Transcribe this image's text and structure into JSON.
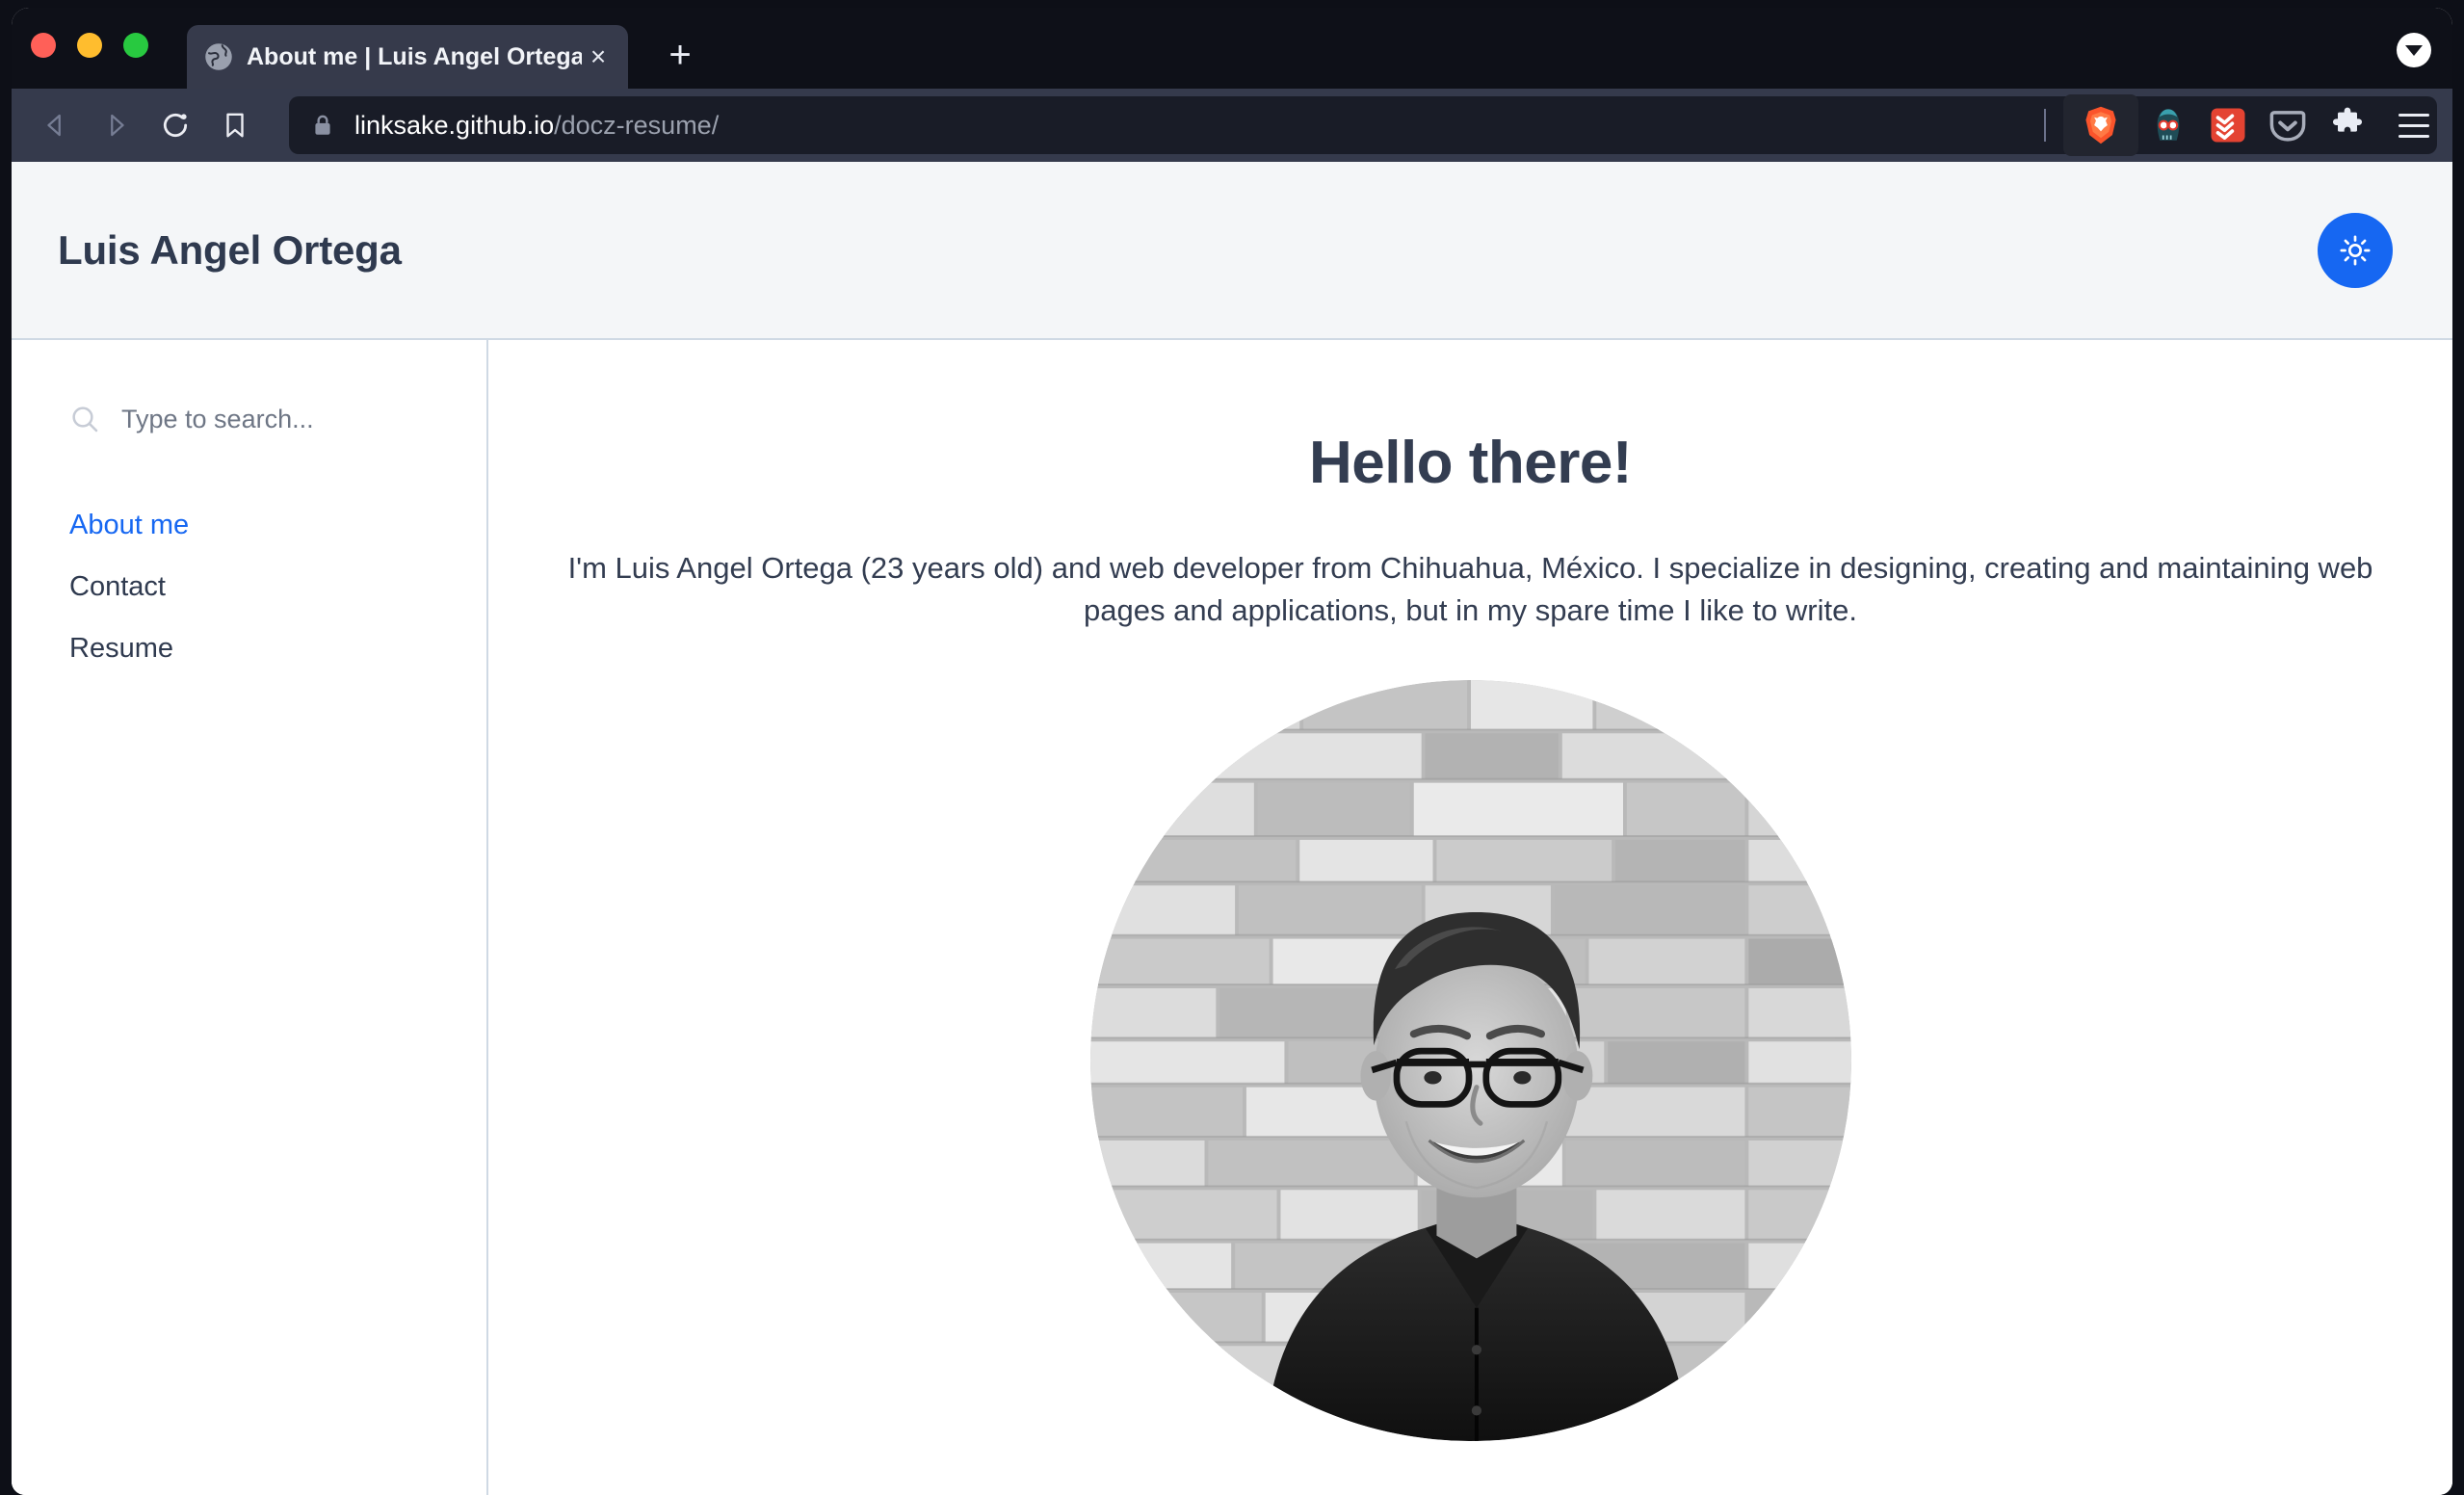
{
  "browser": {
    "window_controls": [
      {
        "name": "close",
        "color": "#ff6058"
      },
      {
        "name": "minimize",
        "color": "#ffbd2e"
      },
      {
        "name": "maximize",
        "color": "#28c940"
      }
    ],
    "tab": {
      "title": "About me | Luis Angel Ortega",
      "favicon": "globe-icon",
      "close_label": "×"
    },
    "new_tab_label": "+",
    "tab_list_icon": "chevron-down-icon",
    "nav": {
      "back_icon": "back-arrow-icon",
      "forward_icon": "forward-arrow-icon",
      "reload_icon": "reload-icon",
      "bookmark_icon": "bookmark-icon"
    },
    "url": {
      "lock_icon": "lock-icon",
      "domain": "linksake.github.io",
      "path": "/docz-resume/"
    },
    "toolbar_icons": [
      {
        "name": "brave-shield-icon",
        "label": "Brave Shields"
      },
      {
        "name": "dark-reader-icon",
        "label": "Dark Reader"
      },
      {
        "name": "todoist-icon",
        "label": "Todoist"
      },
      {
        "name": "pocket-icon",
        "label": "Pocket"
      },
      {
        "name": "extensions-puzzle-icon",
        "label": "Extensions"
      },
      {
        "name": "hamburger-menu-icon",
        "label": "Menu"
      }
    ]
  },
  "site": {
    "header": {
      "title": "Luis Angel Ortega",
      "theme_toggle_icon": "sun-icon",
      "theme_toggle_color": "#1667f2"
    },
    "sidebar": {
      "search": {
        "placeholder": "Type to search...",
        "value": "",
        "icon": "search-icon"
      },
      "items": [
        {
          "label": "About me",
          "active": true
        },
        {
          "label": "Contact",
          "active": false
        },
        {
          "label": "Resume",
          "active": false
        }
      ]
    },
    "main": {
      "heading": "Hello there!",
      "paragraph": "I'm Luis Angel Ortega (23 years old) and web developer from Chihuahua, México. I specialize in designing, creating and maintaining web pages and applications, but in my spare time I like to write.",
      "avatar_alt": "Portrait photo of Luis Angel Ortega in front of a stone wall"
    }
  },
  "colors": {
    "accent": "#1667f2",
    "text": "#333d51",
    "header_bg": "#f4f6f8",
    "border": "#cfd9e4",
    "chrome_tabbar": "#0e1018",
    "chrome_toolbar": "#353a4c",
    "urlbar_bg": "#191c27"
  }
}
